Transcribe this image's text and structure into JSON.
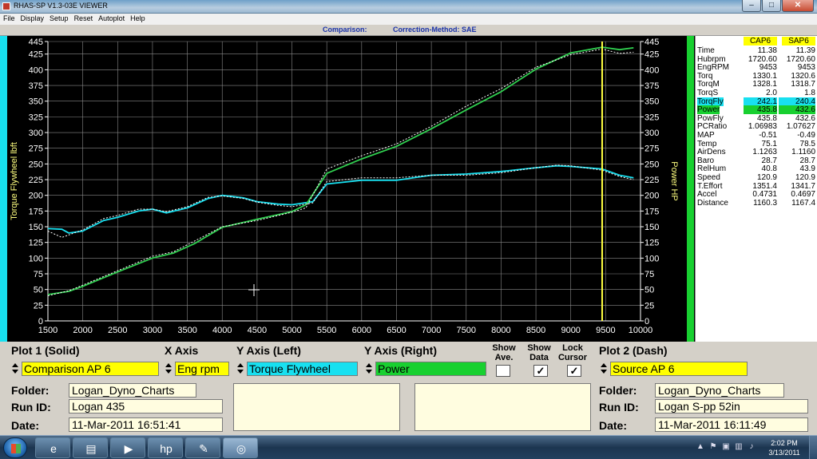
{
  "window": {
    "title": "RHAS-SP V1.3-03E VIEWER",
    "controls": {
      "minimize": "–",
      "maximize": "□",
      "close": "✕"
    }
  },
  "menu": [
    {
      "text": "File",
      "key": "F"
    },
    {
      "text": "Display",
      "key": "D"
    },
    {
      "text": "Setup",
      "key": "S"
    },
    {
      "text": "Reset",
      "key": "R"
    },
    {
      "text": "Autoplot",
      "key": "A"
    },
    {
      "text": "Help",
      "key": "H"
    }
  ],
  "header": {
    "comparison": "Comparison:",
    "correction": "Correction-Method: SAE"
  },
  "chart_data": {
    "type": "line",
    "xlim": [
      1500,
      10000
    ],
    "ylim": [
      0,
      445
    ],
    "x_ticks": [
      1500,
      2000,
      2500,
      3000,
      3500,
      4000,
      4500,
      5000,
      5500,
      6000,
      6500,
      7000,
      7500,
      8000,
      8500,
      9000,
      9500,
      10000
    ],
    "y_ticks": [
      0,
      25,
      50,
      75,
      100,
      125,
      150,
      175,
      200,
      225,
      250,
      275,
      300,
      325,
      350,
      375,
      400,
      425,
      445
    ],
    "ylabel_left": "Torque Flywheel lbft",
    "ylabel_right": "Power HP",
    "grid": true,
    "cursor_x": 9450,
    "series": [
      {
        "name": "Torque Flywheel",
        "color": "#18e0f0",
        "style": "solid",
        "x": [
          1500,
          1700,
          1800,
          2000,
          2300,
          2500,
          2800,
          3000,
          3200,
          3500,
          3800,
          4000,
          4300,
          4500,
          4800,
          5000,
          5300,
          5500,
          6000,
          6500,
          7000,
          7500,
          8000,
          8500,
          8800,
          9000,
          9450,
          9700,
          9900
        ],
        "values": [
          147,
          146,
          140,
          143,
          160,
          165,
          175,
          178,
          172,
          180,
          195,
          200,
          196,
          190,
          186,
          185,
          190,
          218,
          224,
          224,
          232,
          234,
          238,
          244,
          247,
          246,
          242,
          232,
          228
        ]
      },
      {
        "name": "Power",
        "color": "#30d050",
        "style": "solid",
        "x": [
          1500,
          1800,
          2000,
          2500,
          3000,
          3300,
          3600,
          4000,
          4500,
          5000,
          5200,
          5500,
          6000,
          6500,
          7000,
          7500,
          8000,
          8500,
          9000,
          9450,
          9700,
          9900
        ],
        "values": [
          42,
          47,
          55,
          78,
          100,
          108,
          123,
          149,
          162,
          174,
          185,
          235,
          258,
          278,
          306,
          336,
          365,
          401,
          427,
          436,
          432,
          435
        ]
      },
      {
        "name": "Torque Flywheel (Plot 2)",
        "color": "#ffffff",
        "style": "dash",
        "x": [
          1500,
          1700,
          2000,
          2300,
          2500,
          2800,
          3000,
          3200,
          3500,
          3800,
          4000,
          4300,
          4500,
          4800,
          5000,
          5300,
          5500,
          6000,
          6500,
          7000,
          7500,
          8000,
          8500,
          8800,
          9000,
          9450,
          9700,
          9900
        ],
        "values": [
          143,
          133,
          145,
          163,
          168,
          178,
          178,
          174,
          182,
          197,
          199,
          195,
          189,
          184,
          182,
          188,
          222,
          228,
          228,
          232,
          232,
          236,
          244,
          248,
          247,
          240,
          230,
          225
        ]
      },
      {
        "name": "Power (Plot 2)",
        "color": "#ffffff",
        "style": "dash",
        "x": [
          1500,
          1800,
          2000,
          2500,
          3000,
          3300,
          3600,
          4000,
          4500,
          5000,
          5200,
          5500,
          6000,
          6500,
          7000,
          7500,
          8000,
          8500,
          9000,
          9450,
          9700,
          9900
        ],
        "values": [
          40,
          48,
          57,
          80,
          103,
          110,
          127,
          150,
          160,
          173,
          180,
          242,
          263,
          282,
          310,
          342,
          370,
          404,
          424,
          433,
          426,
          428
        ]
      }
    ]
  },
  "data_panel": {
    "col1": "CAP6",
    "col2": "SAP6",
    "rows": [
      {
        "label": "Time",
        "v1": "11.38",
        "v2": "11.39",
        "hl": ""
      },
      {
        "label": "Hubrpm",
        "v1": "1720.60",
        "v2": "1720.60",
        "hl": ""
      },
      {
        "label": "EngRPM",
        "v1": "9453",
        "v2": "9453",
        "hl": ""
      },
      {
        "label": "Torq",
        "v1": "1330.1",
        "v2": "1320.6",
        "hl": ""
      },
      {
        "label": "TorqM",
        "v1": "1328.1",
        "v2": "1318.7",
        "hl": ""
      },
      {
        "label": "TorqS",
        "v1": "2.0",
        "v2": "1.8",
        "hl": ""
      },
      {
        "label": "TorqFly",
        "v1": "242.1",
        "v2": "240.4",
        "hl": "cyan"
      },
      {
        "label": "Power",
        "v1": "435.8",
        "v2": "432.6",
        "hl": "green"
      },
      {
        "label": "PowFly",
        "v1": "435.8",
        "v2": "432.6",
        "hl": ""
      },
      {
        "label": "PCRatio",
        "v1": "1.06983",
        "v2": "1.07627",
        "hl": ""
      },
      {
        "label": "MAP",
        "v1": "-0.51",
        "v2": "-0.49",
        "hl": ""
      },
      {
        "label": "Temp",
        "v1": "75.1",
        "v2": "78.5",
        "hl": ""
      },
      {
        "label": "AirDens",
        "v1": "1.1263",
        "v2": "1.1160",
        "hl": ""
      },
      {
        "label": "Baro",
        "v1": "28.7",
        "v2": "28.7",
        "hl": ""
      },
      {
        "label": "RelHum",
        "v1": "40.8",
        "v2": "43.9",
        "hl": ""
      },
      {
        "label": "Speed",
        "v1": "120.9",
        "v2": "120.9",
        "hl": ""
      },
      {
        "label": "T.Effort",
        "v1": "1351.4",
        "v2": "1341.7",
        "hl": ""
      },
      {
        "label": "Accel",
        "v1": "0.4731",
        "v2": "0.4697",
        "hl": ""
      },
      {
        "label": "Distance",
        "v1": "1160.3",
        "v2": "1167.4",
        "hl": ""
      }
    ]
  },
  "controls": {
    "plot1_label": "Plot 1 (Solid)",
    "plot1_value": "Comparison AP 6",
    "xaxis_label": "X Axis",
    "xaxis_value": "Eng rpm",
    "yleft_label": "Y Axis (Left)",
    "yleft_value": "Torque Flywheel",
    "yright_label": "Y Axis (Right)",
    "yright_value": "Power",
    "show_ave_label": "Show Ave.",
    "show_data_label": "Show Data",
    "lock_cursor_label": "Lock Cursor",
    "show_ave_checked": "",
    "show_data_checked": "✓",
    "lock_cursor_checked": "✓",
    "plot2_label": "Plot 2 (Dash)",
    "plot2_value": "Source AP 6",
    "folder_label": "Folder:",
    "runid_label": "Run ID:",
    "date_label": "Date:",
    "plot1_folder": "Logan_Dyno_Charts",
    "plot1_runid": "Logan 435",
    "plot1_date": "11-Mar-2011  16:51:41",
    "plot2_folder": "Logan_Dyno_Charts",
    "plot2_runid": "Logan S-pp 52in",
    "plot2_date": "11-Mar-2011  16:11:49",
    "colors": {
      "yellow": "#ffff00",
      "cyan": "#18e0f0",
      "green": "#18d030"
    }
  },
  "taskbar": {
    "clock_time": "2:02 PM",
    "clock_date": "3/13/2011",
    "apps": [
      "ie-icon",
      "explorer-icon",
      "media-player-icon",
      "hp-icon",
      "notepad-icon",
      "network-app-icon"
    ]
  }
}
